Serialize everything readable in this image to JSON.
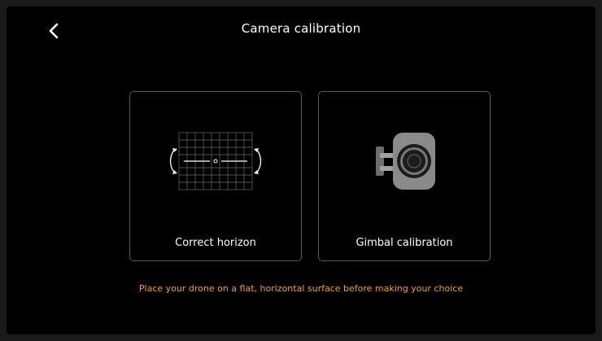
{
  "header": {
    "title": "Camera calibration",
    "back_icon": "chevron-left-icon"
  },
  "options": [
    {
      "label": "Correct horizon",
      "icon": "horizon-grid-icon"
    },
    {
      "label": "Gimbal calibration",
      "icon": "gimbal-camera-icon"
    }
  ],
  "hint": "Place your drone on a flat, horizontal surface before making your choice",
  "colors": {
    "background": "#000000",
    "card_border": "#5a5a5a",
    "hint": "#e8a33c",
    "gimbal_body": "#8a8a8a"
  }
}
